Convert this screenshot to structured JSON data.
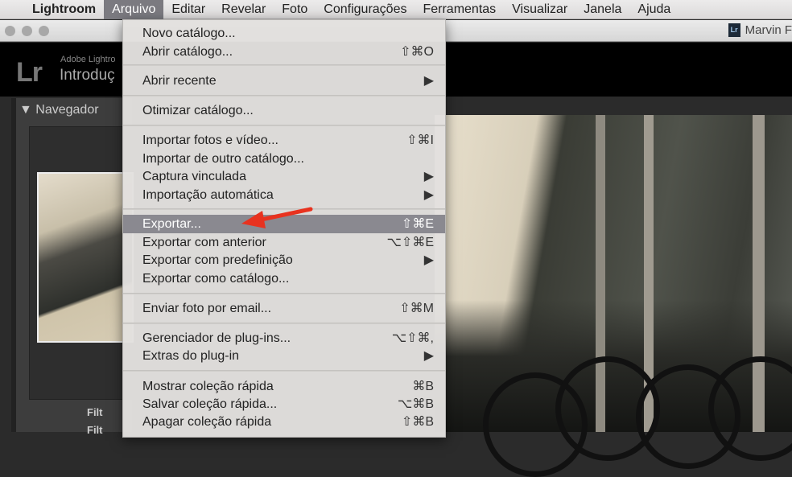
{
  "menubar": {
    "apple": "",
    "app": "Lightroom",
    "items": [
      "Arquivo",
      "Editar",
      "Revelar",
      "Foto",
      "Configurações",
      "Ferramentas",
      "Visualizar",
      "Janela",
      "Ajuda"
    ]
  },
  "titlebar": {
    "doc_icon": "Lr",
    "doc_title": "Marvin F"
  },
  "header": {
    "logo": "Lr",
    "brand": "Adobe Lightro",
    "catalog": "Introduç"
  },
  "left_panel": {
    "navigator": "▼ Navegador",
    "filter1": "Filt",
    "filter2": "Filt"
  },
  "menu": {
    "items": [
      {
        "label": "Novo catálogo...",
        "shortcut": ""
      },
      {
        "label": "Abrir catálogo...",
        "shortcut": "⇧⌘O"
      },
      {
        "label": "Abrir recente",
        "shortcut": "▶"
      },
      {
        "label": "Otimizar catálogo...",
        "shortcut": ""
      },
      {
        "label": "Importar fotos e vídeo...",
        "shortcut": "⇧⌘I"
      },
      {
        "label": "Importar de outro catálogo...",
        "shortcut": ""
      },
      {
        "label": "Captura vinculada",
        "shortcut": "▶"
      },
      {
        "label": "Importação automática",
        "shortcut": "▶"
      },
      {
        "label": "Exportar...",
        "shortcut": "⇧⌘E"
      },
      {
        "label": "Exportar com anterior",
        "shortcut": "⌥⇧⌘E"
      },
      {
        "label": "Exportar com predefinição",
        "shortcut": "▶"
      },
      {
        "label": "Exportar como catálogo...",
        "shortcut": ""
      },
      {
        "label": "Enviar foto por email...",
        "shortcut": "⇧⌘M"
      },
      {
        "label": "Gerenciador de plug-ins...",
        "shortcut": "⌥⇧⌘,"
      },
      {
        "label": "Extras do plug-in",
        "shortcut": "▶"
      },
      {
        "label": "Mostrar coleção rápida",
        "shortcut": "⌘B"
      },
      {
        "label": "Salvar coleção rápida...",
        "shortcut": "⌥⌘B"
      },
      {
        "label": "Apagar coleção rápida",
        "shortcut": "⇧⌘B"
      }
    ]
  },
  "colors": {
    "highlight": "#8a8990",
    "arrow": "#e8321f"
  }
}
